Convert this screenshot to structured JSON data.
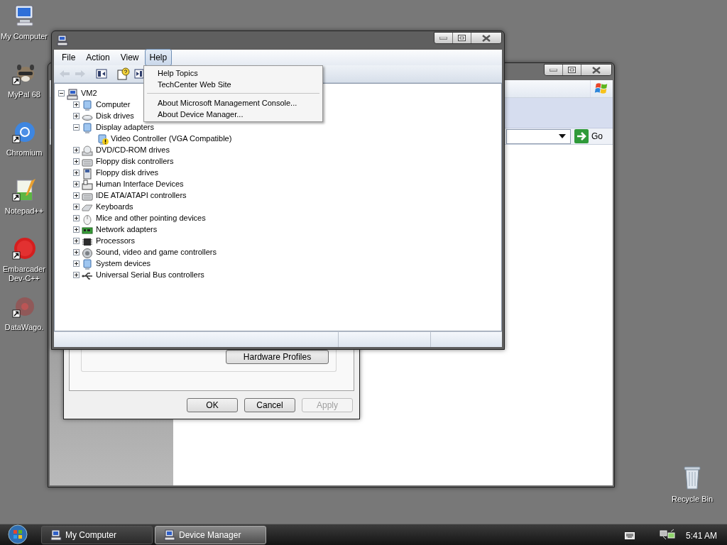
{
  "desktop_icons": [
    {
      "label": "My Computer"
    },
    {
      "label": "MyPal 68"
    },
    {
      "label": "Chromium"
    },
    {
      "label": "Notepad++"
    },
    {
      "label": "Embarcader Dev-C++"
    },
    {
      "label": "DataWago."
    }
  ],
  "recycle_bin": {
    "label": "Recycle Bin"
  },
  "background_window": {
    "go_button": "Go"
  },
  "properties_dialog": {
    "group_button": {
      "label": "Hardware Profiles"
    },
    "buttons": [
      {
        "label": "OK",
        "disabled": false
      },
      {
        "label": "Cancel",
        "disabled": false
      },
      {
        "label": "Apply",
        "disabled": true
      }
    ]
  },
  "device_manager": {
    "menu": [
      {
        "label": "File",
        "selected": false
      },
      {
        "label": "Action",
        "selected": false
      },
      {
        "label": "View",
        "selected": false
      },
      {
        "label": "Help",
        "selected": true
      }
    ],
    "help_menu": [
      {
        "kind": "item",
        "label": "Help Topics"
      },
      {
        "kind": "item",
        "label": "TechCenter Web Site"
      },
      {
        "kind": "separator"
      },
      {
        "kind": "item",
        "label": "About Microsoft Management Console..."
      },
      {
        "kind": "item",
        "label": "About Device Manager..."
      }
    ],
    "tree": {
      "label": "VM2",
      "expanded": true,
      "children": [
        {
          "label": "Computer",
          "expanded": false
        },
        {
          "label": "Disk drives",
          "expanded": false
        },
        {
          "label": "Display adapters",
          "expanded": true,
          "children": [
            {
              "label": "Video Controller (VGA Compatible)",
              "warning": true
            }
          ]
        },
        {
          "label": "DVD/CD-ROM drives",
          "expanded": false
        },
        {
          "label": "Floppy disk controllers",
          "expanded": false
        },
        {
          "label": "Floppy disk drives",
          "expanded": false
        },
        {
          "label": "Human Interface Devices",
          "expanded": false
        },
        {
          "label": "IDE ATA/ATAPI controllers",
          "expanded": false
        },
        {
          "label": "Keyboards",
          "expanded": false
        },
        {
          "label": "Mice and other pointing devices",
          "expanded": false
        },
        {
          "label": "Network adapters",
          "expanded": false
        },
        {
          "label": "Processors",
          "expanded": false
        },
        {
          "label": "Sound, video and game controllers",
          "expanded": false
        },
        {
          "label": "System devices",
          "expanded": false
        },
        {
          "label": "Universal Serial Bus controllers",
          "expanded": false
        }
      ]
    }
  },
  "taskbar": {
    "buttons": [
      {
        "label": "My Computer",
        "selected": false
      },
      {
        "label": "Device Manager",
        "selected": true
      }
    ],
    "clock": "5:41 AM"
  }
}
